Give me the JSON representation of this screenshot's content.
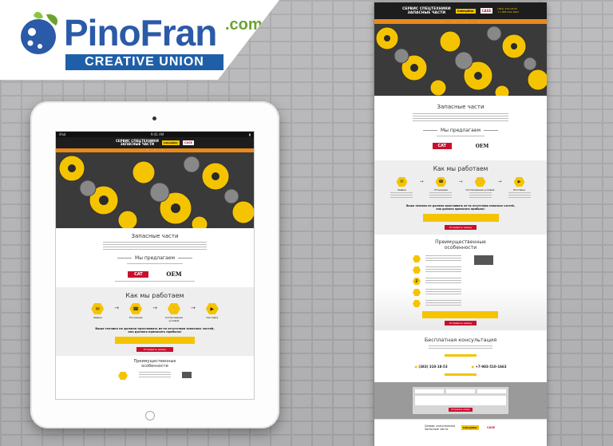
{
  "logo": {
    "name": "PinoFran",
    "com": ".com",
    "tagline": "CREATIVE UNION"
  },
  "colors": {
    "brand_blue": "#2b5aa8",
    "brand_green": "#6aa32f",
    "accent_yellow": "#f5c400",
    "accent_orange": "#e78a1b",
    "accent_red": "#c8102e"
  },
  "tablet": {
    "status_left": "iPad",
    "status_center": "9:41 AM",
    "header_title_1": "СЕРВИС СПЕЦТЕХНИКИ",
    "header_title_2": "ЗАПАСНЫЕ ЧАСТИ",
    "brand_badge": "Caterpillar",
    "case_badge": "CASE",
    "parts_title": "Запасные части",
    "offer_title": "Мы предлагаем",
    "cat_logo": "CAT",
    "oem_logo": "OEM",
    "how_title": "Как мы работаем",
    "steps": [
      "Заявка",
      "Уточнение",
      "Согласование условий",
      "Поставка"
    ],
    "question": "Ваша техника не должна простаивать из-за отсутствия запасных частей, она должна приносить прибыль!",
    "red_button": "Отправить заявку",
    "advantages_title": "Преимущественные особенности"
  },
  "page": {
    "header_title_1": "СЕРВИС СПЕЦТЕХНИКИ",
    "header_title_2": "ЗАПАСНЫЕ ЧАСТИ",
    "brand_badge": "Caterpillar",
    "case_badge": "CASE",
    "parts_title": "Запасные части",
    "offer_title": "Мы предлагаем",
    "cat_logo": "CAT",
    "oem_logo": "OEM",
    "how_title": "Как мы работаем",
    "steps": [
      "Заявка",
      "Уточнение",
      "Согласование условий",
      "Поставка"
    ],
    "question": "Ваша техника не должна простаивать из-за отсутствия запасных частей, она должна приносить прибыль!",
    "red_button": "Отправить заявку",
    "advantages_title": "Преимущественные особенности",
    "consult_title": "Бесплатная консультация",
    "phone_1": "(383) 310-18-53",
    "phone_2": "+7-983-510-1663",
    "footer_brand_1": "Сервис спецтехники",
    "footer_brand_2": "Запасные части"
  }
}
